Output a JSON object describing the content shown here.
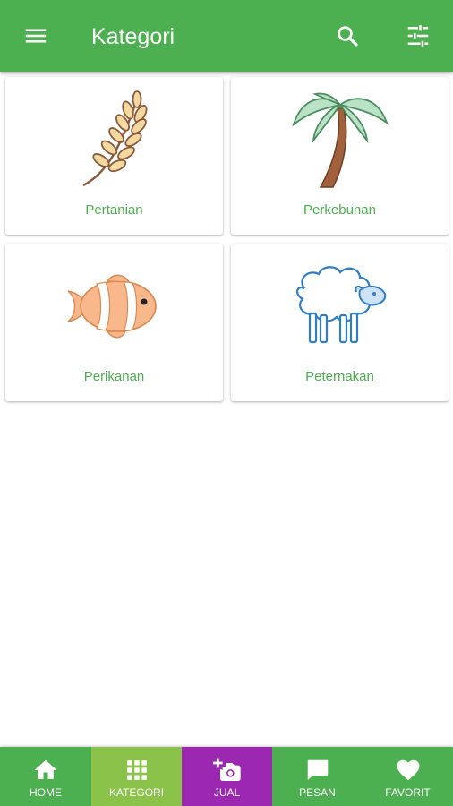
{
  "appbar": {
    "title": "Kategori",
    "icons": [
      "menu-icon",
      "search-icon",
      "tune-icon"
    ],
    "color": "#4caf50"
  },
  "categories": [
    {
      "label": "Pertanian",
      "icon": "wheat-icon"
    },
    {
      "label": "Perkebunan",
      "icon": "palm-tree-icon"
    },
    {
      "label": "Perikanan",
      "icon": "fish-icon"
    },
    {
      "label": "Peternakan",
      "icon": "sheep-icon"
    }
  ],
  "bottom_nav": {
    "items": [
      {
        "label": "HOME",
        "icon": "home-icon"
      },
      {
        "label": "KATEGORI",
        "icon": "grid-icon",
        "active": true
      },
      {
        "label": "JUAL",
        "icon": "add-photo-icon"
      },
      {
        "label": "PESAN",
        "icon": "chat-icon"
      },
      {
        "label": "FAVORIT",
        "icon": "heart-icon"
      }
    ],
    "colors": {
      "base": "#4caf50",
      "active": "#8bc34a",
      "jual": "#9c27b0"
    }
  }
}
